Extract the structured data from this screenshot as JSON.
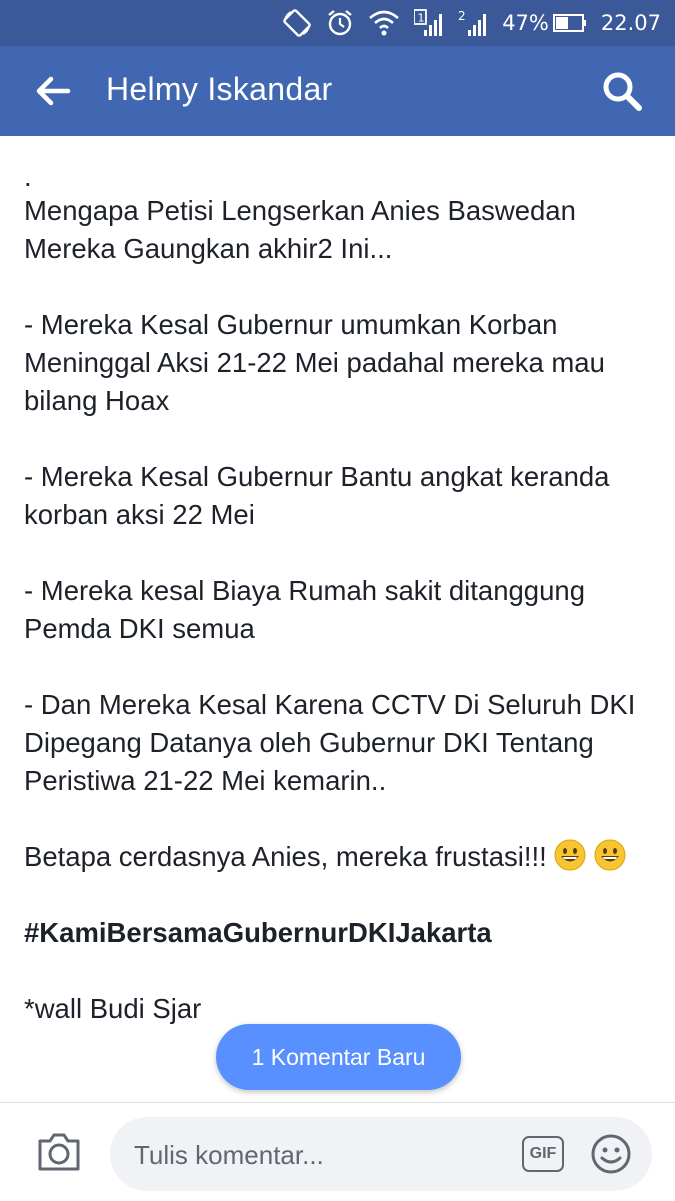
{
  "status_bar": {
    "battery_percent": "47%",
    "time": "22.07",
    "sim1_label": "1",
    "sim2_label": "2",
    "icons": [
      "screen-rotate-icon",
      "alarm-icon",
      "wifi-icon",
      "signal-sim1-icon",
      "signal-sim2-icon",
      "battery-icon"
    ]
  },
  "app_bar": {
    "title": "Helmy Iskandar",
    "back_icon": "back-arrow-icon",
    "search_icon": "search-icon"
  },
  "post": {
    "dot": ".",
    "headline": "Mengapa Petisi Lengserkan Anies Baswedan Mereka Gaungkan akhir2 Ini...",
    "point1": "- Mereka Kesal Gubernur umumkan Korban Meninggal Aksi 21-22 Mei padahal mereka mau bilang Hoax",
    "point2": "- Mereka Kesal Gubernur Bantu angkat keranda korban aksi 22 Mei",
    "point3": "- Mereka kesal Biaya Rumah sakit ditanggung Pemda DKI semua",
    "point4": "- Dan Mereka Kesal Karena CCTV Di Seluruh DKI Dipegang Datanya oleh Gubernur DKI Tentang Peristiwa 21-22 Mei kemarin..",
    "conclusion": "Betapa cerdasnya Anies, mereka frustasi!!!",
    "hashtag": "#KamiBersamaGubernurDKIJakarta",
    "credit": "*wall Budi Sjar"
  },
  "new_comment_button": {
    "label": "1 Komentar Baru"
  },
  "comment_bar": {
    "placeholder": "Tulis komentar...",
    "gif_label": "GIF",
    "camera_icon": "camera-icon",
    "emoji_icon": "smiley-icon"
  },
  "colors": {
    "status_bar": "#3b5998",
    "app_bar": "#4267b2",
    "button": "#5890ff",
    "text": "#1d2129"
  }
}
